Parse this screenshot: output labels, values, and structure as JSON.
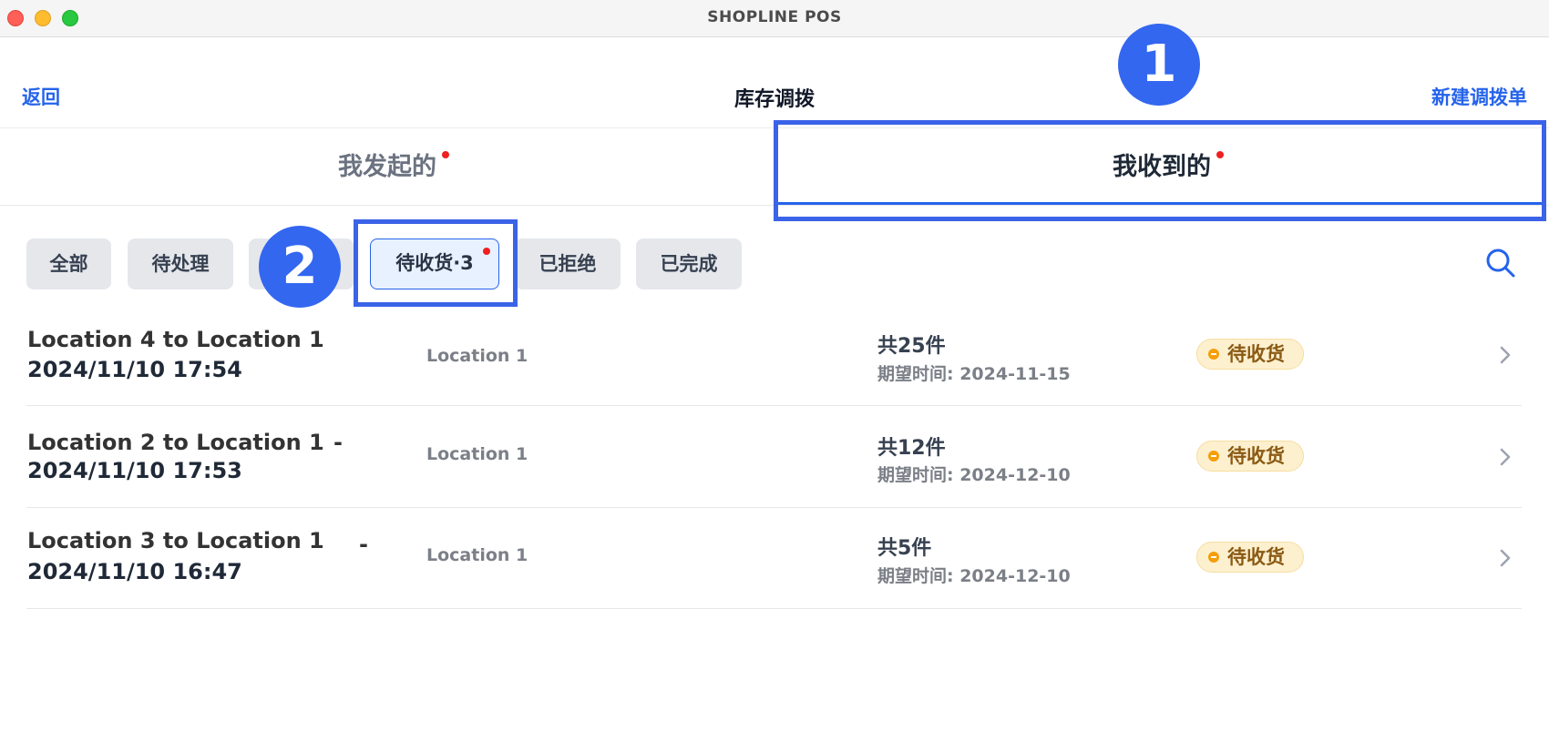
{
  "window": {
    "title": "SHOPLINE POS"
  },
  "navbar": {
    "back_label": "返回",
    "title": "库存调拨",
    "new_label": "新建调拨单"
  },
  "tabs": [
    {
      "label": "我发起的",
      "active": false,
      "has_dot": true
    },
    {
      "label": "我收到的",
      "active": true,
      "has_dot": true
    }
  ],
  "annotations": {
    "one": "1",
    "two": "2"
  },
  "filters": [
    {
      "label": "全部"
    },
    {
      "label": "待处理"
    },
    {
      "label": "待收货·3",
      "active": true
    },
    {
      "label": "已拒绝"
    },
    {
      "label": "已完成"
    }
  ],
  "transfers": [
    {
      "route": "Location 4 to Location 1",
      "dash": "",
      "datetime": "2024/11/10 17:54",
      "location": "Location 1",
      "count": "共25件",
      "expected": "期望时间: 2024-11-15",
      "status": "待收货"
    },
    {
      "route": "Location 2 to Location 1",
      "dash": "-",
      "datetime": "2024/11/10 17:53",
      "location": "Location 1",
      "count": "共12件",
      "expected": "期望时间: 2024-12-10",
      "status": "待收货"
    },
    {
      "route": "Location 3 to Location 1",
      "dash": "-",
      "datetime": "2024/11/10 16:47",
      "location": "Location 1",
      "count": "共5件",
      "expected": "期望时间: 2024-12-10",
      "status": "待收货"
    }
  ],
  "colors": {
    "accent": "#2563eb",
    "highlight": "#3b63e8",
    "status_bg": "#fdf0cf",
    "dot": "#ef2020"
  },
  "icons": {
    "search": "search-icon",
    "chevron": "chevron-right-icon"
  }
}
